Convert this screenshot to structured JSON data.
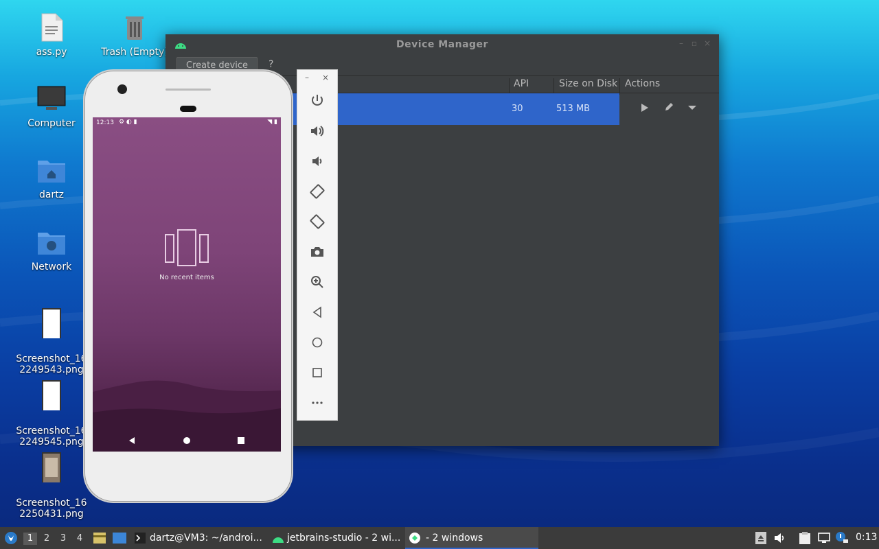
{
  "desktop": {
    "icons": [
      {
        "label": "ass.py"
      },
      {
        "label": "Trash (Empty)"
      },
      {
        "label": "Computer"
      },
      {
        "label": "dartz"
      },
      {
        "label": "Network"
      },
      {
        "label": "Screenshot_16\n2249543.png"
      },
      {
        "label": "Screenshot_16\n2249545.png"
      },
      {
        "label": "Screenshot_16\n2250431.png"
      }
    ]
  },
  "device_manager": {
    "title": "Device Manager",
    "create_button": "Create device",
    "help": "?",
    "columns": {
      "api": "API",
      "size": "Size on Disk",
      "actions": "Actions"
    },
    "row": {
      "api": "30",
      "size": "513 MB"
    }
  },
  "phone": {
    "time": "12:13",
    "empty_text": "No recent items"
  },
  "taskbar": {
    "workspaces": [
      "1",
      "2",
      "3",
      "4"
    ],
    "tasks": [
      {
        "label": "dartz@VM3: ~/androi..."
      },
      {
        "label": "jetbrains-studio - 2 wi..."
      },
      {
        "label": "- 2 windows"
      }
    ],
    "clock": "0:13"
  },
  "colors": {
    "accent": "#2f65ca",
    "android_green": "#3ddc84"
  }
}
